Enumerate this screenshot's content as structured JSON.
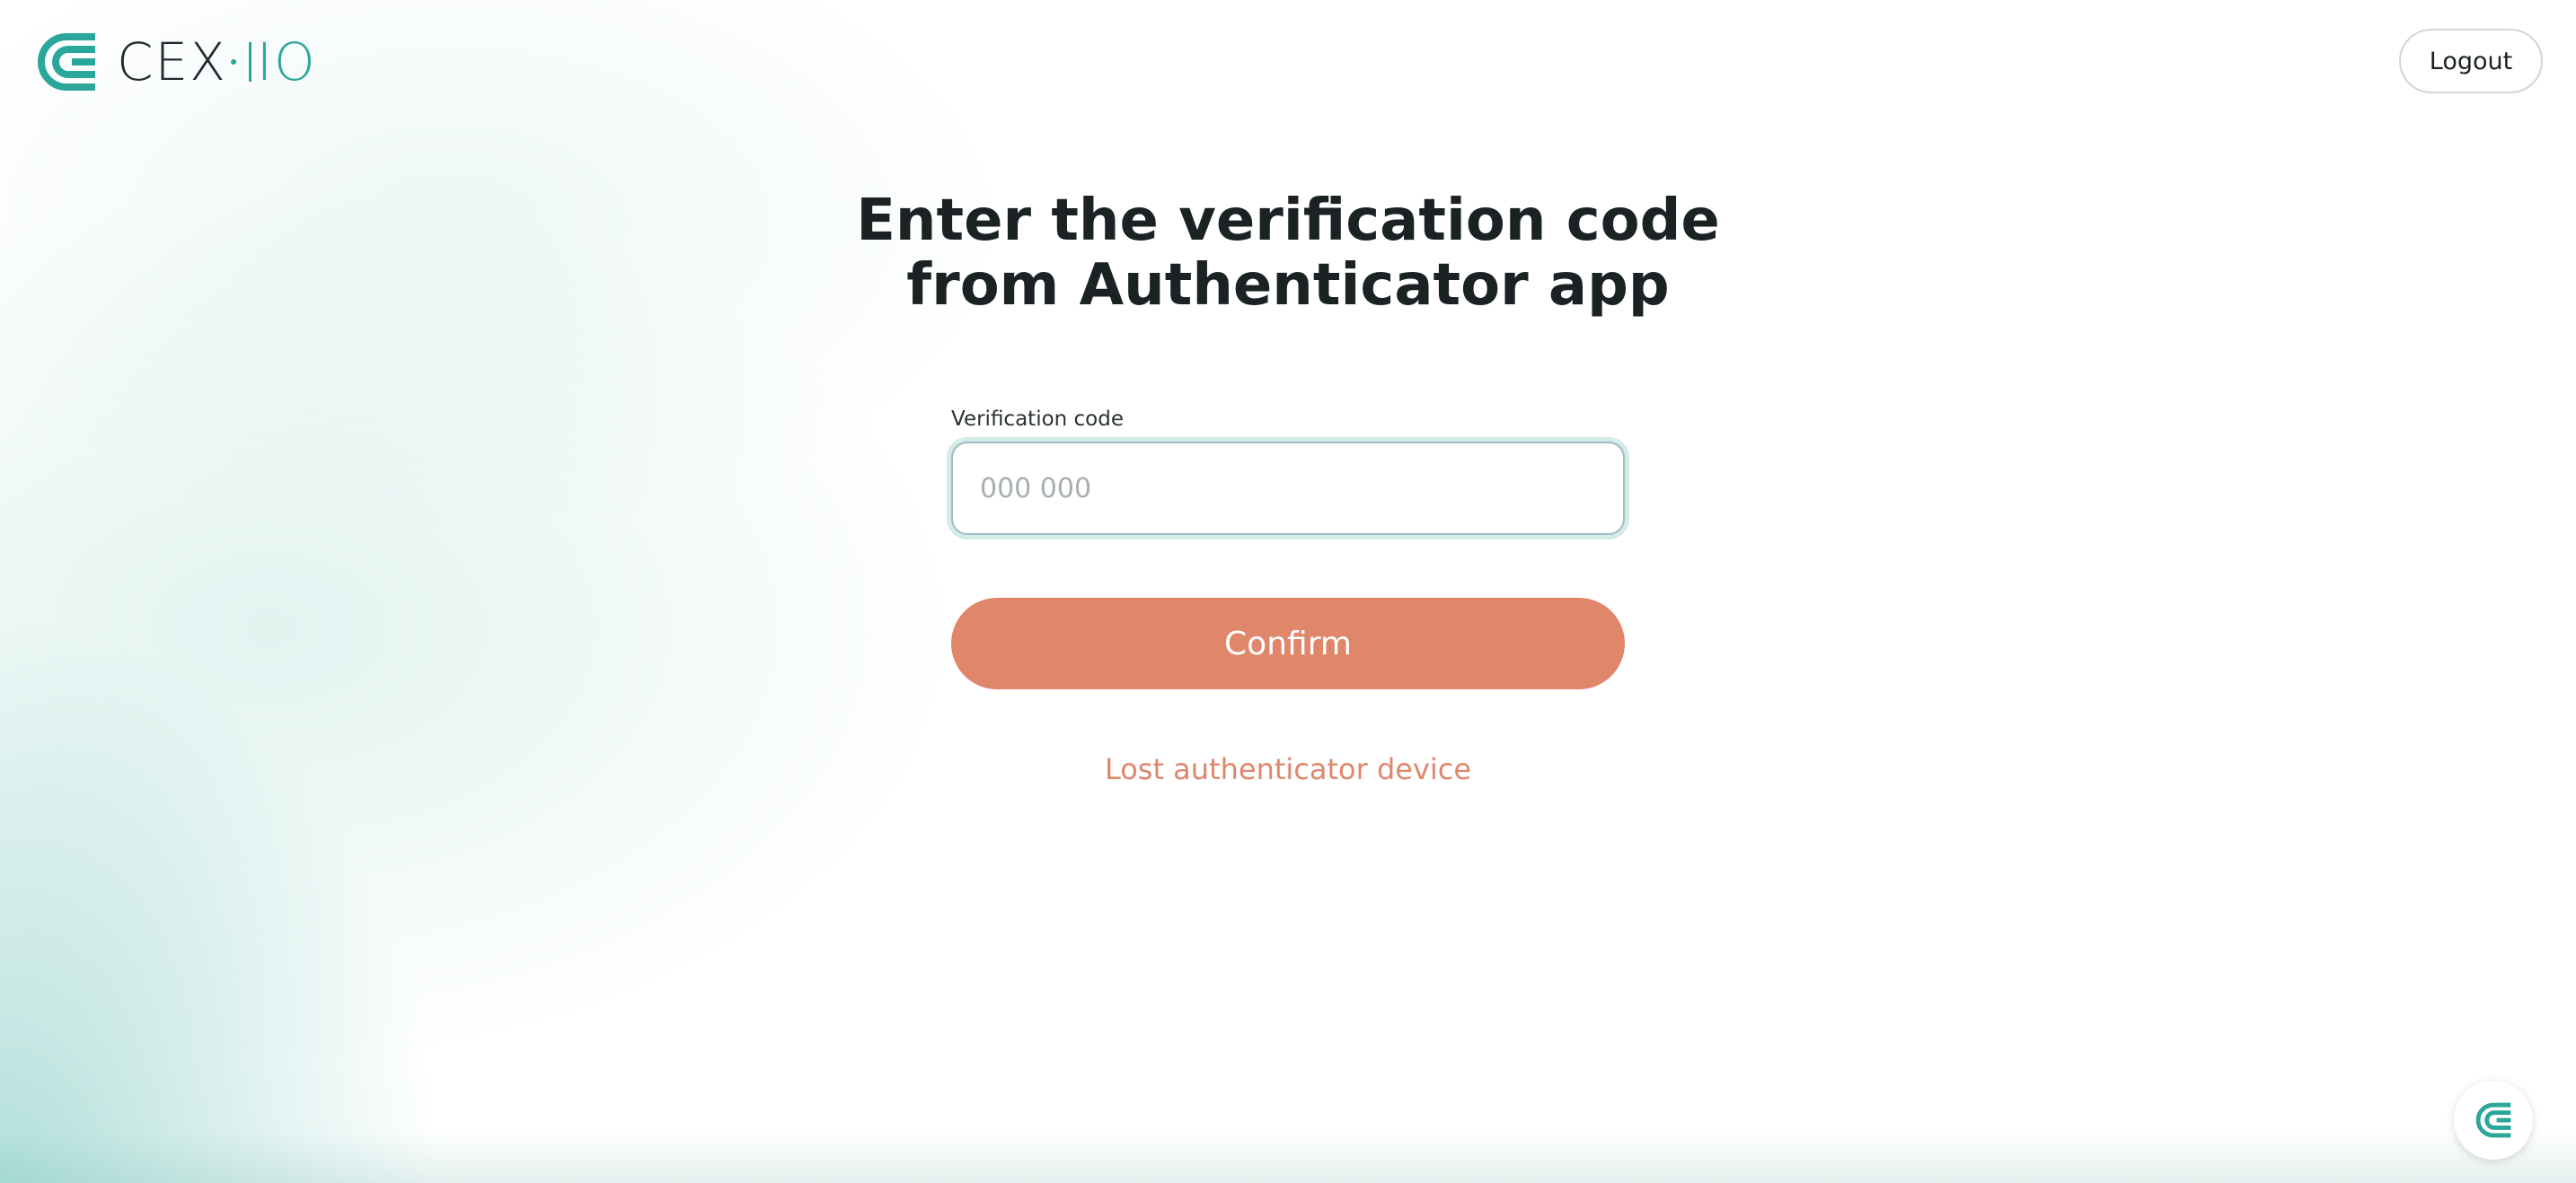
{
  "brand": {
    "logo_icon": "cex-io-logo-icon",
    "name_part1": "CEX",
    "name_part2": "IO",
    "accent_color": "#2aa79a"
  },
  "header": {
    "logout_label": "Logout"
  },
  "main": {
    "title": "Enter the verification code from Authenticator app",
    "code_field": {
      "label": "Verification code",
      "value": "",
      "placeholder": "000 000"
    },
    "confirm_label": "Confirm",
    "confirm_color": "#e0866b",
    "lost_device_link": "Lost authenticator device"
  },
  "chat_widget": {
    "icon": "cex-io-chat-icon"
  }
}
